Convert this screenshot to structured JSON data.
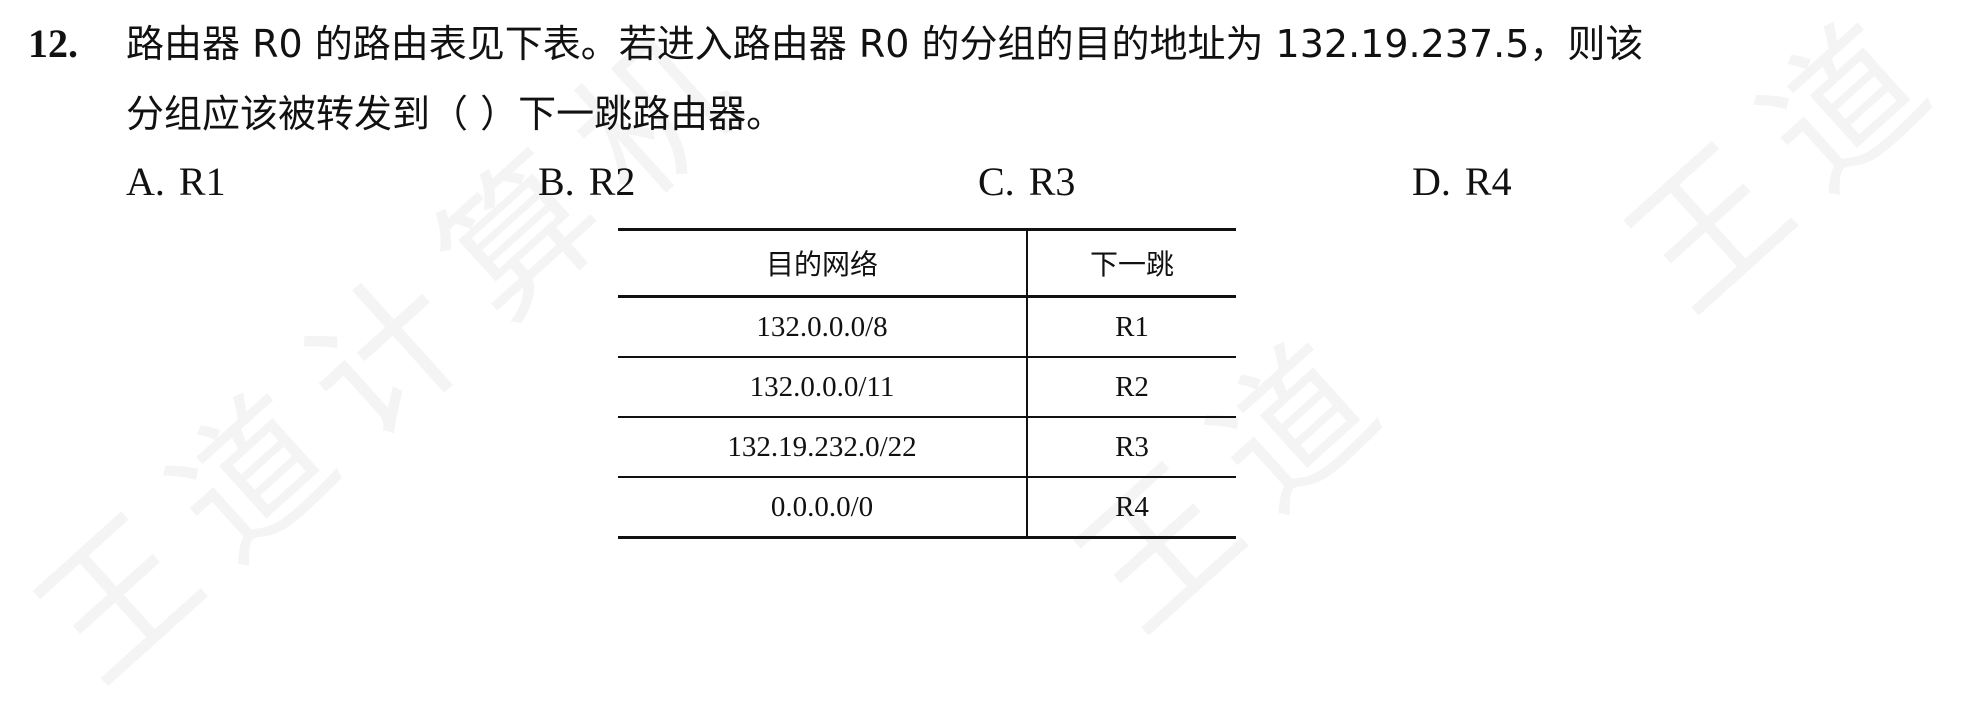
{
  "question": {
    "number": "12.",
    "line1": "路由器 R0 的路由表见下表。若进入路由器 R0 的分组的目的地址为 132.19.237.5，则该",
    "line2": "分组应该被转发到（   ）下一跳路由器。"
  },
  "options": [
    {
      "letter": "A.",
      "text": "R1"
    },
    {
      "letter": "B.",
      "text": "R2"
    },
    {
      "letter": "C.",
      "text": "R3"
    },
    {
      "letter": "D.",
      "text": "R4"
    }
  ],
  "table": {
    "headers": [
      "目的网络",
      "下一跳"
    ],
    "rows": [
      [
        "132.0.0.0/8",
        "R1"
      ],
      [
        "132.0.0.0/11",
        "R2"
      ],
      [
        "132.19.232.0/22",
        "R3"
      ],
      [
        "0.0.0.0/0",
        "R4"
      ]
    ]
  },
  "watermark": {
    "text1": "王道计算机",
    "text2": "王道",
    "text3": "王道"
  }
}
